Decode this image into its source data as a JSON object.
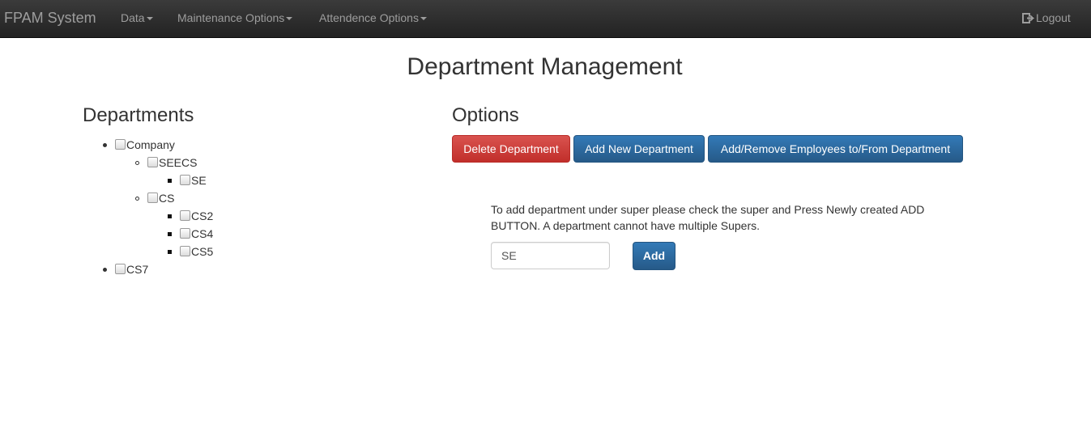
{
  "navbar": {
    "brand": "FPAM System",
    "menus": [
      {
        "label": "Data"
      },
      {
        "label": "Maintenance Options"
      },
      {
        "label": "Attendence Options"
      }
    ],
    "logout_label": "Logout"
  },
  "page_title": "Department Management",
  "departments": {
    "heading": "Departments",
    "tree": [
      {
        "label": "Company",
        "level": 0
      },
      {
        "label": "SEECS",
        "level": 1
      },
      {
        "label": "SE",
        "level": 2
      },
      {
        "label": "CS",
        "level": 1
      },
      {
        "label": "CS2",
        "level": 2
      },
      {
        "label": "CS4",
        "level": 2
      },
      {
        "label": "CS5",
        "level": 2
      },
      {
        "label": "CS7",
        "level": 0
      }
    ]
  },
  "options": {
    "heading": "Options",
    "delete_label": "Delete Department",
    "add_new_label": "Add New Department",
    "add_remove_label": "Add/Remove Employees to/From Department",
    "help_text": "To add department under super please check the super and Press Newly created ADD BUTTON. A department cannot have multiple Supers.",
    "input_value": "SE",
    "add_label": "Add"
  },
  "colors": {
    "navbar_bg": "#222222",
    "danger": "#d9534f",
    "primary": "#337ab7"
  }
}
